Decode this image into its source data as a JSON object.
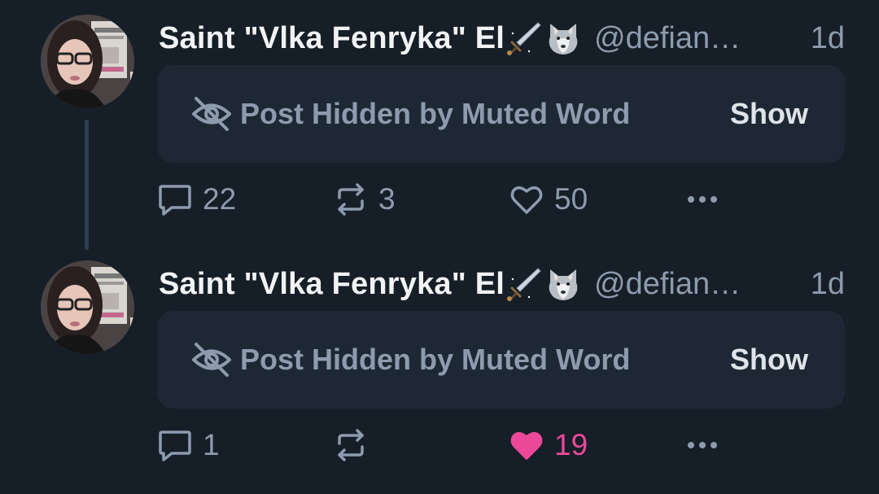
{
  "posts": [
    {
      "author_name": "Saint \"Vlka Fenryka\" El",
      "handle": "@defian…",
      "timestamp": "1d",
      "hidden_label": "Post Hidden by Muted Word",
      "show_label": "Show",
      "reply_count": "22",
      "repost_count": "3",
      "like_count": "50",
      "liked": false
    },
    {
      "author_name": "Saint \"Vlka Fenryka\" El",
      "handle": "@defian…",
      "timestamp": "1d",
      "hidden_label": "Post Hidden by Muted Word",
      "show_label": "Show",
      "reply_count": "1",
      "repost_count": "",
      "like_count": "19",
      "liked": true
    }
  ],
  "colors": {
    "background": "#161e27",
    "card": "#1e2834",
    "muted_text": "#8d9bad",
    "like_active": "#ec4899"
  },
  "icons": [
    "dagger-emoji",
    "wolf-emoji",
    "eye-slash-icon",
    "reply-icon",
    "repost-icon",
    "heart-icon",
    "more-icon"
  ]
}
